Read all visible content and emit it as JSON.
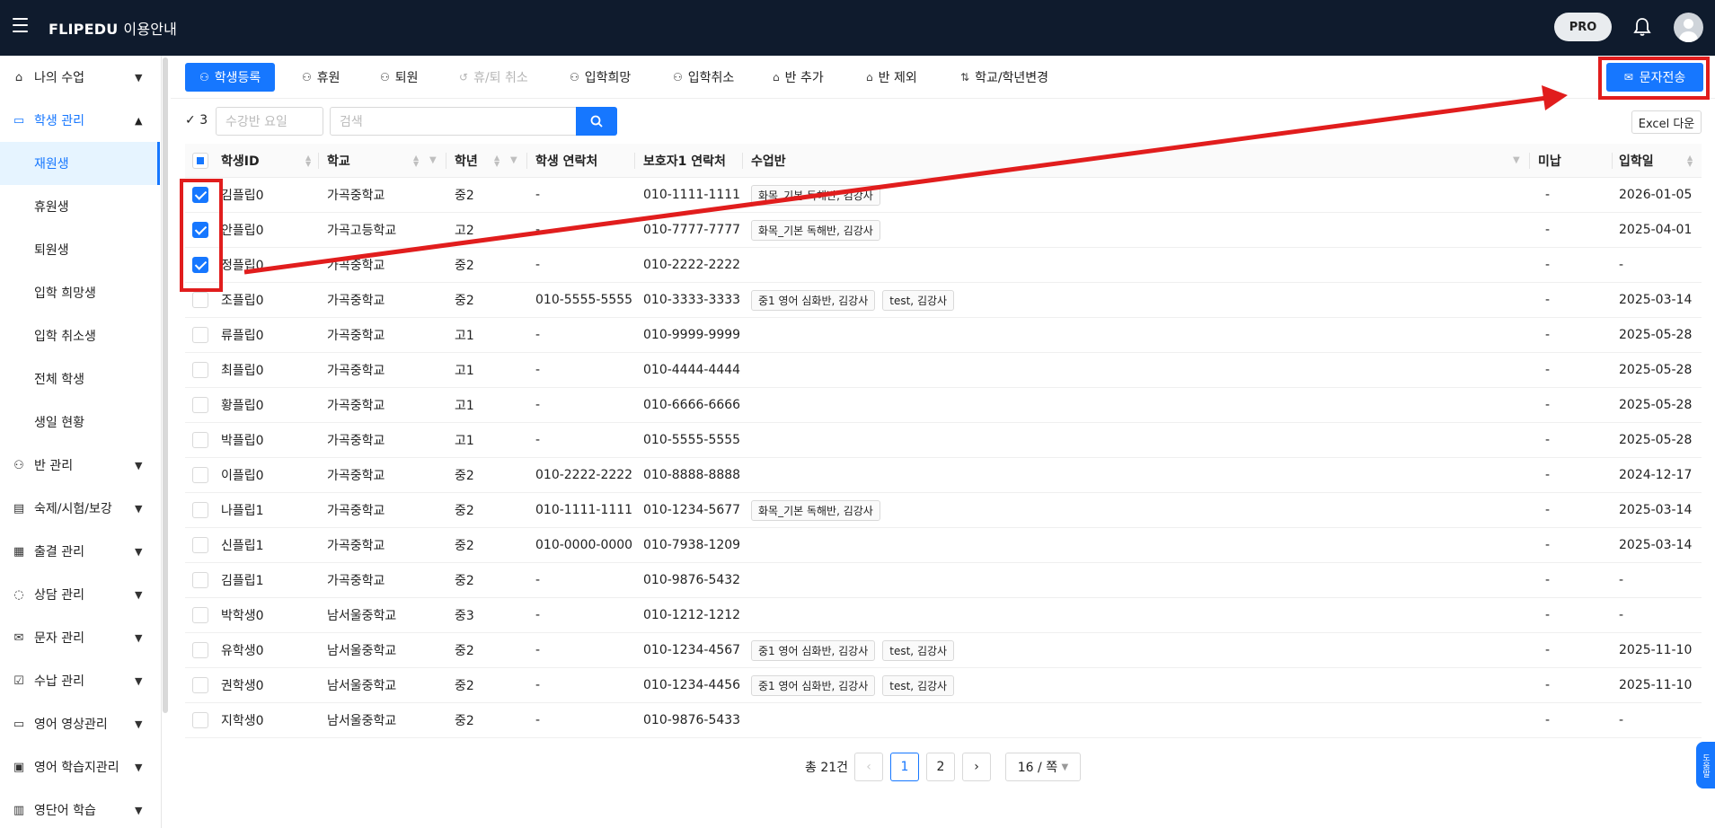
{
  "app": {
    "brand": "FLIPEDU",
    "brand_sub": "이용안내",
    "pro_label": "PRO"
  },
  "sidebar": {
    "items": [
      {
        "label": "나의 수업",
        "icon": "home-icon"
      },
      {
        "label": "학생 관리",
        "icon": "id-card-icon"
      },
      {
        "label": "반 관리",
        "icon": "people-icon"
      },
      {
        "label": "숙제/시험/보강",
        "icon": "document-icon"
      },
      {
        "label": "출결 관리",
        "icon": "calendar-icon"
      },
      {
        "label": "상담 관리",
        "icon": "chat-icon"
      },
      {
        "label": "문자 관리",
        "icon": "mail-icon"
      },
      {
        "label": "수납 관리",
        "icon": "receipt-icon"
      },
      {
        "label": "영어 영상관리",
        "icon": "monitor-icon"
      },
      {
        "label": "영어 학습지관리",
        "icon": "worksheet-icon"
      },
      {
        "label": "영단어 학습",
        "icon": "vocabulary-icon"
      }
    ],
    "sub_items": [
      "재원생",
      "휴원생",
      "퇴원생",
      "입학 희망생",
      "입학 취소생",
      "전체 학생",
      "생일 현황"
    ]
  },
  "toolbar": {
    "buttons": [
      "학생등록",
      "휴원",
      "퇴원",
      "휴/퇴 취소",
      "입학희망",
      "입학취소",
      "반 추가",
      "반 제외",
      "학교/학년변경"
    ],
    "sms_label": "문자전송"
  },
  "filter": {
    "selected_count": "3",
    "class_day_placeholder": "수강반 요일",
    "search_placeholder": "검색",
    "excel_label": "Excel 다운"
  },
  "table": {
    "headers": [
      "학생ID",
      "학교",
      "학년",
      "학생 연락처",
      "보호자1 연락처",
      "수업반",
      "미납",
      "입학일"
    ],
    "rows": [
      {
        "checked": true,
        "id": "김플립0",
        "school": "가곡중학교",
        "grade": "중2",
        "phone": "-",
        "parent": "010-1111-1111",
        "classes": [
          "화목_기본 독해반, 김강사"
        ],
        "unpaid": "-",
        "date": "2026-01-05"
      },
      {
        "checked": true,
        "id": "안플립0",
        "school": "가곡고등학교",
        "grade": "고2",
        "phone": "-",
        "parent": "010-7777-7777",
        "classes": [
          "화목_기본 독해반, 김강사"
        ],
        "unpaid": "-",
        "date": "2025-04-01"
      },
      {
        "checked": true,
        "id": "정플립0",
        "school": "가곡중학교",
        "grade": "중2",
        "phone": "-",
        "parent": "010-2222-2222",
        "classes": [],
        "unpaid": "-",
        "date": "-"
      },
      {
        "checked": false,
        "id": "조플립0",
        "school": "가곡중학교",
        "grade": "중2",
        "phone": "010-5555-5555",
        "parent": "010-3333-3333",
        "classes": [
          "중1 영어 심화반, 김강사",
          "test, 김강사"
        ],
        "unpaid": "-",
        "date": "2025-03-14"
      },
      {
        "checked": false,
        "id": "류플립0",
        "school": "가곡중학교",
        "grade": "고1",
        "phone": "-",
        "parent": "010-9999-9999",
        "classes": [],
        "unpaid": "-",
        "date": "2025-05-28"
      },
      {
        "checked": false,
        "id": "최플립0",
        "school": "가곡중학교",
        "grade": "고1",
        "phone": "-",
        "parent": "010-4444-4444",
        "classes": [],
        "unpaid": "-",
        "date": "2025-05-28"
      },
      {
        "checked": false,
        "id": "황플립0",
        "school": "가곡중학교",
        "grade": "고1",
        "phone": "-",
        "parent": "010-6666-6666",
        "classes": [],
        "unpaid": "-",
        "date": "2025-05-28"
      },
      {
        "checked": false,
        "id": "박플립0",
        "school": "가곡중학교",
        "grade": "고1",
        "phone": "-",
        "parent": "010-5555-5555",
        "classes": [],
        "unpaid": "-",
        "date": "2025-05-28"
      },
      {
        "checked": false,
        "id": "이플립0",
        "school": "가곡중학교",
        "grade": "중2",
        "phone": "010-2222-2222",
        "parent": "010-8888-8888",
        "classes": [],
        "unpaid": "-",
        "date": "2024-12-17"
      },
      {
        "checked": false,
        "id": "나플립1",
        "school": "가곡중학교",
        "grade": "중2",
        "phone": "010-1111-1111",
        "parent": "010-1234-5677",
        "classes": [
          "화목_기본 독해반, 김강사"
        ],
        "unpaid": "-",
        "date": "2025-03-14"
      },
      {
        "checked": false,
        "id": "신플립1",
        "school": "가곡중학교",
        "grade": "중2",
        "phone": "010-0000-0000",
        "parent": "010-7938-1209",
        "classes": [],
        "unpaid": "-",
        "date": "2025-03-14"
      },
      {
        "checked": false,
        "id": "김플립1",
        "school": "가곡중학교",
        "grade": "중2",
        "phone": "-",
        "parent": "010-9876-5432",
        "classes": [],
        "unpaid": "-",
        "date": "-"
      },
      {
        "checked": false,
        "id": "박학생0",
        "school": "남서울중학교",
        "grade": "중3",
        "phone": "-",
        "parent": "010-1212-1212",
        "classes": [],
        "unpaid": "-",
        "date": "-"
      },
      {
        "checked": false,
        "id": "유학생0",
        "school": "남서울중학교",
        "grade": "중2",
        "phone": "-",
        "parent": "010-1234-4567",
        "classes": [
          "중1 영어 심화반, 김강사",
          "test, 김강사"
        ],
        "unpaid": "-",
        "date": "2025-11-10"
      },
      {
        "checked": false,
        "id": "권학생0",
        "school": "남서울중학교",
        "grade": "중2",
        "phone": "-",
        "parent": "010-1234-4456",
        "classes": [
          "중1 영어 심화반, 김강사",
          "test, 김강사"
        ],
        "unpaid": "-",
        "date": "2025-11-10"
      },
      {
        "checked": false,
        "id": "지학생0",
        "school": "남서울중학교",
        "grade": "중2",
        "phone": "-",
        "parent": "010-9876-5433",
        "classes": [],
        "unpaid": "-",
        "date": "-"
      }
    ]
  },
  "pagination": {
    "total_label": "총 21건",
    "pages": [
      "1",
      "2"
    ],
    "current": "1",
    "page_size": "16 / 쪽"
  },
  "help_tab": "도움말",
  "colors": {
    "accent": "#1677ff",
    "topbar": "#0f1b2d",
    "annotation": "#e11d1d"
  }
}
